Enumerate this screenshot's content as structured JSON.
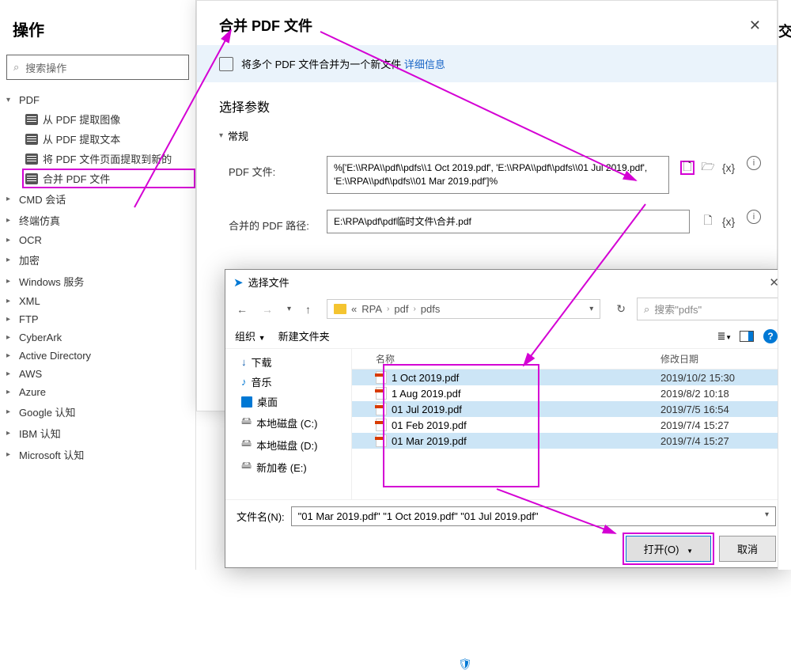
{
  "leftPanel": {
    "title": "操作",
    "searchPlaceholder": "搜索操作",
    "pdfGroup": "PDF",
    "pdfItems": [
      "从 PDF 提取图像",
      "从 PDF 提取文本",
      "将 PDF 文件页面提取到新的",
      "合并 PDF 文件"
    ],
    "groups": [
      "CMD 会话",
      "终端仿真",
      "OCR",
      "加密",
      "Windows 服务",
      "XML",
      "FTP",
      "CyberArk",
      "Active Directory",
      "AWS",
      "Azure",
      "Google 认知",
      "IBM 认知",
      "Microsoft 认知"
    ]
  },
  "modal": {
    "title": "合并 PDF 文件",
    "bannerText": "将多个 PDF 文件合并为一个新文件",
    "bannerLink": "详细信息",
    "sectionTitle": "选择参数",
    "subgroup": "常规",
    "param1Label": "PDF 文件:",
    "param1Value": "%['E:\\\\RPA\\\\pdf\\\\pdfs\\\\1 Oct 2019.pdf', 'E:\\\\RPA\\\\pdf\\\\pdfs\\\\01 Jul 2019.pdf', 'E:\\\\RPA\\\\pdf\\\\pdfs\\\\01 Mar 2019.pdf']%",
    "param2Label": "合并的 PDF 路径:",
    "param2Value": "E:\\RPA\\pdf\\pdf临时文件\\合并.pdf",
    "varToken": "{x}"
  },
  "fileDialog": {
    "title": "选择文件",
    "crumbs": [
      "RPA",
      "pdf",
      "pdfs"
    ],
    "crumbPrefix": "«",
    "searchPlaceholder": "搜索\"pdfs\"",
    "organize": "组织",
    "newFolder": "新建文件夹",
    "colName": "名称",
    "colDate": "修改日期",
    "sidebar": [
      "下载",
      "音乐",
      "桌面",
      "本地磁盘 (C:)",
      "本地磁盘 (D:)",
      "新加卷 (E:)"
    ],
    "files": [
      {
        "name": "1 Oct 2019.pdf",
        "date": "2019/10/2 15:30",
        "sel": true
      },
      {
        "name": "1 Aug 2019.pdf",
        "date": "2019/8/2 10:18",
        "sel": false
      },
      {
        "name": "01 Jul 2019.pdf",
        "date": "2019/7/5 16:54",
        "sel": true
      },
      {
        "name": "01 Feb 2019.pdf",
        "date": "2019/7/4 15:27",
        "sel": false
      },
      {
        "name": "01 Mar 2019.pdf",
        "date": "2019/7/4 15:27",
        "sel": true
      }
    ],
    "filenameLabel": "文件名(N):",
    "filenameValue": "\"01 Mar 2019.pdf\" \"1 Oct 2019.pdf\" \"01 Jul 2019.pdf\"",
    "openBtn": "打开(O)",
    "cancelBtn": "取消"
  },
  "rightSliver": "交"
}
